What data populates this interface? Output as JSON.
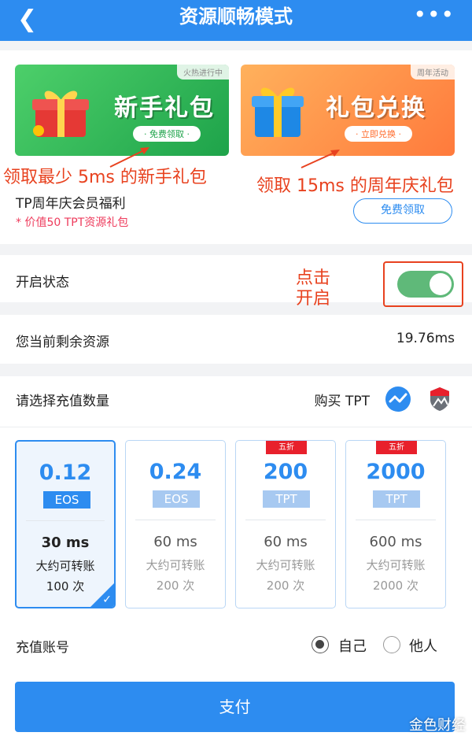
{
  "header": {
    "title": "资源顺畅模式",
    "back_icon": "chevron-left-icon",
    "more_icon": "more-dots-icon"
  },
  "banners": [
    {
      "tag": "火热进行中",
      "title": "新手礼包",
      "button": "· 免费领取 ·"
    },
    {
      "tag": "周年活动",
      "title": "礼包兑换",
      "button": "· 立即兑换 ·"
    }
  ],
  "annotations": {
    "left": "领取最少 5ms 的新手礼包",
    "right": "领取 15ms 的周年庆礼包",
    "toggle_line1": "点击",
    "toggle_line2": "开启"
  },
  "welfare": {
    "title": "TP周年庆会员福利",
    "subtitle": "* 价值50 TPT资源礼包",
    "button": "免费领取"
  },
  "status": {
    "label": "开启状态",
    "enabled": true
  },
  "resource": {
    "label": "您当前剩余资源",
    "value": "19.76ms"
  },
  "recharge": {
    "label": "请选择充值数量",
    "buy_label": "购买 TPT"
  },
  "cards": [
    {
      "amount": "0.12",
      "unit": "EOS",
      "ms": "30 ms",
      "line1": "大约可转账",
      "line2": "100 次",
      "badge": "",
      "selected": true
    },
    {
      "amount": "0.24",
      "unit": "EOS",
      "ms": "60 ms",
      "line1": "大约可转账",
      "line2": "200 次",
      "badge": "",
      "selected": false
    },
    {
      "amount": "200",
      "unit": "TPT",
      "ms": "60 ms",
      "line1": "大约可转账",
      "line2": "200 次",
      "badge": "五折",
      "selected": false
    },
    {
      "amount": "2000",
      "unit": "TPT",
      "ms": "600 ms",
      "line1": "大约可转账",
      "line2": "2000 次",
      "badge": "五折",
      "selected": false
    }
  ],
  "account": {
    "label": "充值账号",
    "options": [
      "自己",
      "他人"
    ],
    "selected": "自己"
  },
  "pay_button": "支付",
  "watermark": "金色财经",
  "colors": {
    "primary": "#2d8cf0",
    "annotation": "#e8421f",
    "toggle_on": "#5fb979",
    "badge": "#e8202c"
  }
}
